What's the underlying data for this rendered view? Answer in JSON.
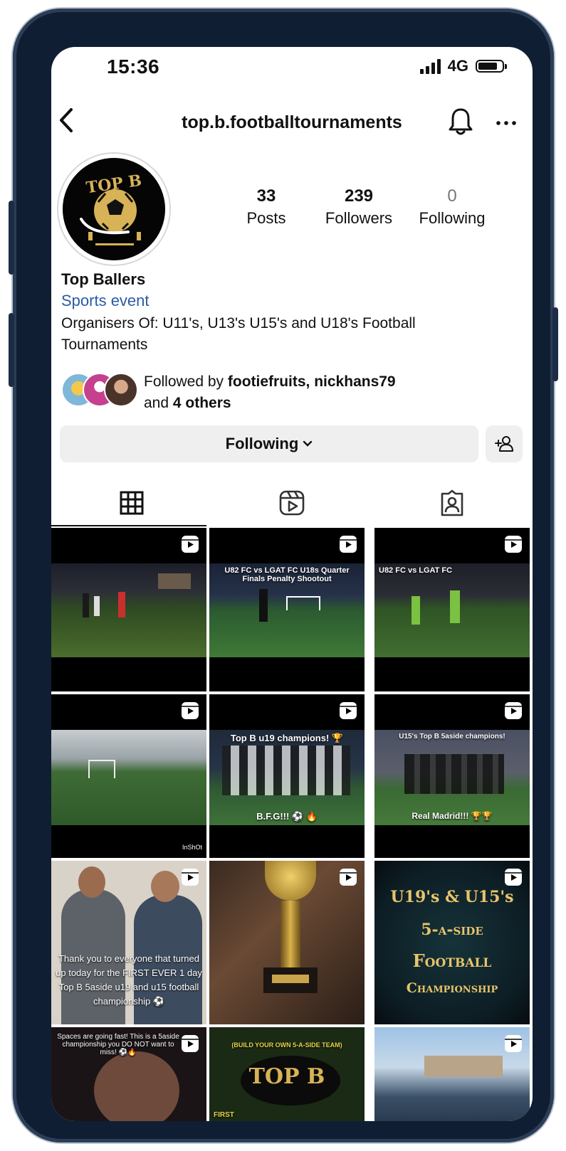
{
  "status_bar": {
    "time": "15:36",
    "network": "4G"
  },
  "header": {
    "username": "top.b.footballtournaments"
  },
  "profile": {
    "logo_text": "TOP B",
    "stats": [
      {
        "value": "33",
        "label": "Posts"
      },
      {
        "value": "239",
        "label": "Followers"
      },
      {
        "value": "0",
        "label": "Following"
      }
    ],
    "name": "Top Ballers",
    "category": "Sports event",
    "bio": "Organisers Of: U11's, U13's U15's and U18's Football Tournaments",
    "followed_by": {
      "prefix": "Followed by ",
      "user1": "footiefruits",
      "sep": ", ",
      "user2": "nickhans79",
      "and": "and ",
      "others": "4 others"
    }
  },
  "actions": {
    "following_label": "Following"
  },
  "grid": {
    "captions": {
      "c2": "U82 FC vs LGAT FC U18s Quarter Finals Penalty Shootout",
      "c3": "U82 FC vs LGAT FC",
      "c5_top": "Top B u19 champions! 🏆",
      "c5_bottom": "B.F.G!!! ⚽ 🔥",
      "c6_top": "U15's Top B 5aside champions!",
      "c6_bottom": "Real Madrid!!! 🏆🏆",
      "c4_wm": "InShOt",
      "c7": "Thank you to everyone that turned up today for the FIRST EVER 1 day Top B 5aside u19 and u15 football championship ⚽",
      "c9_l1": "U19's & U15's",
      "c9_l2": "5-a-side",
      "c9_l3": "Football",
      "c9_l4": "Championship",
      "c10": "Spaces are going fast! This is a 5aside championship you DO NOT want to miss! ⚽🔥",
      "c11_top": "(BUILD YOUR OWN 5-A-SIDE TEAM)",
      "c11_logo": "TOP B",
      "c11_first": "FIRST"
    }
  },
  "colors": {
    "category_link": "#2a5aa8",
    "button_bg": "#efefef",
    "gold": "#e7c46b"
  }
}
